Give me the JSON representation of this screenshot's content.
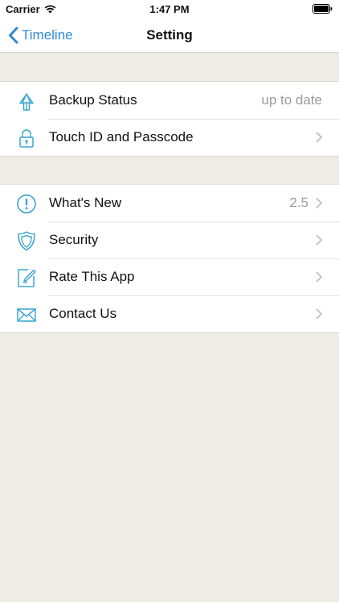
{
  "status_bar": {
    "carrier": "Carrier",
    "time": "1:47 PM"
  },
  "nav": {
    "back_label": "Timeline",
    "title": "Setting"
  },
  "colors": {
    "accent": "#2f8ad6",
    "icon": "#3aa5cf",
    "background": "#efebe5"
  },
  "groups": [
    {
      "rows": [
        {
          "icon": "upload-arrow-icon",
          "label": "Backup Status",
          "value": "up to date",
          "chevron": false
        },
        {
          "icon": "lock-icon",
          "label": "Touch ID and Passcode",
          "value": "",
          "chevron": true
        }
      ]
    },
    {
      "rows": [
        {
          "icon": "exclamation-circle-icon",
          "label": "What's New",
          "value": "2.5",
          "chevron": true
        },
        {
          "icon": "shield-icon",
          "label": "Security",
          "value": "",
          "chevron": true
        },
        {
          "icon": "edit-pencil-icon",
          "label": "Rate This App",
          "value": "",
          "chevron": true
        },
        {
          "icon": "envelope-icon",
          "label": "Contact Us",
          "value": "",
          "chevron": true
        }
      ]
    }
  ]
}
